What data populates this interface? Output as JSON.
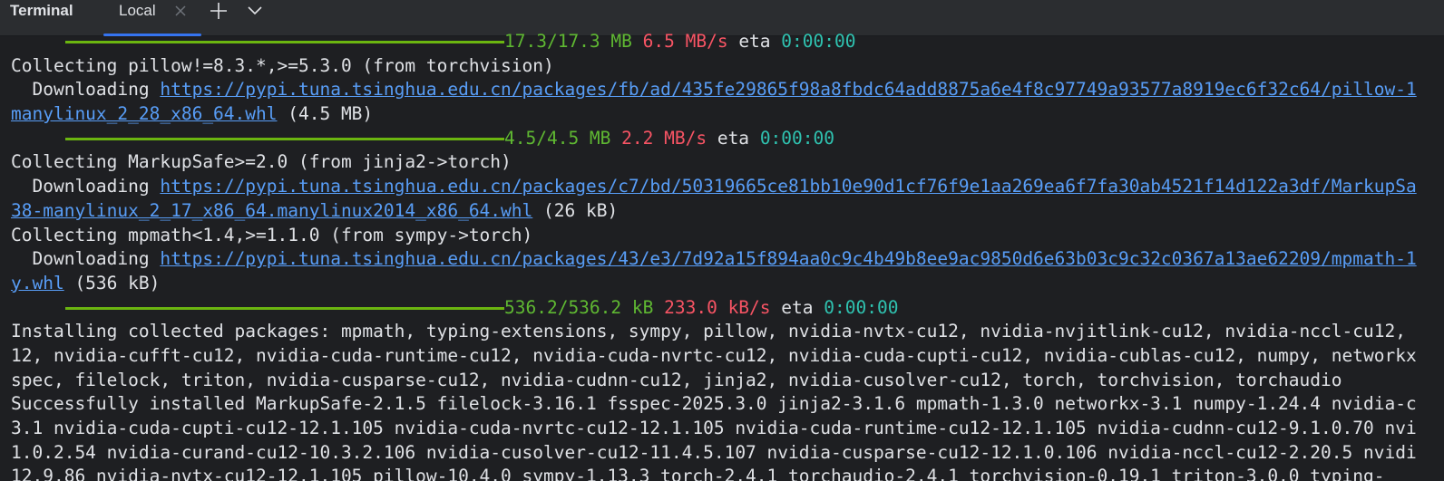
{
  "toolwindow": {
    "title": "Terminal"
  },
  "tabs": [
    {
      "label": "Local",
      "active": true
    }
  ],
  "icons": {
    "close": "close-icon",
    "add": "plus-icon",
    "dropdown": "chevron-down-icon"
  },
  "colors": {
    "background": "#1e1f22",
    "tabbar": "#2b2d30",
    "text": "#dfe1e5",
    "link": "#589df6",
    "progress": "#6bb510",
    "size": "#5fb832",
    "speed": "#f75464",
    "eta": "#2fc2b0",
    "accent": "#3574f0"
  },
  "terminal": {
    "progress": [
      {
        "size": "17.3/17.3 MB",
        "speed": "6.5 MB/s",
        "eta_label": "eta",
        "eta": "0:00:00"
      },
      {
        "size": "4.5/4.5 MB",
        "speed": "2.2 MB/s",
        "eta_label": "eta",
        "eta": "0:00:00"
      },
      {
        "size": "536.2/536.2 kB",
        "speed": "233.0 kB/s",
        "eta_label": "eta",
        "eta": "0:00:00"
      }
    ],
    "collect_pillow": "Collecting pillow!=8.3.*,>=5.3.0 (from torchvision)",
    "dl_prefix": "  Downloading ",
    "pillow_url_1": "https://pypi.tuna.tsinghua.edu.cn/packages/fb/ad/435fe29865f98a8fbdc64add8875a6e4f8c97749a93577a8919ec6f32c64/pillow-1",
    "pillow_url_2": "manylinux_2_28_x86_64.whl",
    "pillow_size": " (4.5 MB)",
    "collect_markupsafe": "Collecting MarkupSafe>=2.0 (from jinja2->torch)",
    "markupsafe_url_1": "https://pypi.tuna.tsinghua.edu.cn/packages/c7/bd/50319665ce81bb10e90d1cf76f9e1aa269ea6f7fa30ab4521f14d122a3df/MarkupSa",
    "markupsafe_url_2": "38-manylinux_2_17_x86_64.manylinux2014_x86_64.whl",
    "markupsafe_size": " (26 kB)",
    "collect_mpmath": "Collecting mpmath<1.4,>=1.1.0 (from sympy->torch)",
    "mpmath_url_1": "https://pypi.tuna.tsinghua.edu.cn/packages/43/e3/7d92a15f894aa0c9c4b49b8ee9ac9850d6e63b03c9c32c0367a13ae62209/mpmath-1",
    "mpmath_url_2": "y.whl",
    "mpmath_size": " (536 kB)",
    "installing_1": "Installing collected packages: mpmath, typing-extensions, sympy, pillow, nvidia-nvtx-cu12, nvidia-nvjitlink-cu12, nvidia-nccl-cu12,",
    "installing_2": "12, nvidia-cufft-cu12, nvidia-cuda-runtime-cu12, nvidia-cuda-nvrtc-cu12, nvidia-cuda-cupti-cu12, nvidia-cublas-cu12, numpy, networkx",
    "installing_3": "spec, filelock, triton, nvidia-cusparse-cu12, nvidia-cudnn-cu12, jinja2, nvidia-cusolver-cu12, torch, torchvision, torchaudio",
    "success_1": "Successfully installed MarkupSafe-2.1.5 filelock-3.16.1 fsspec-2025.3.0 jinja2-3.1.6 mpmath-1.3.0 networkx-3.1 numpy-1.24.4 nvidia-c",
    "success_2": "3.1 nvidia-cuda-cupti-cu12-12.1.105 nvidia-cuda-nvrtc-cu12-12.1.105 nvidia-cuda-runtime-cu12-12.1.105 nvidia-cudnn-cu12-9.1.0.70 nvi",
    "success_3": "1.0.2.54 nvidia-curand-cu12-10.3.2.106 nvidia-cusolver-cu12-11.4.5.107 nvidia-cusparse-cu12-12.1.0.106 nvidia-nccl-cu12-2.20.5 nvidi",
    "success_4": "12.9.86 nvidia-nvtx-cu12-12.1.105 pillow-10.4.0 sympy-1.13.3 torch-2.4.1 torchaudio-2.4.1 torchvision-0.19.1 triton-3.0.0 typing-"
  }
}
